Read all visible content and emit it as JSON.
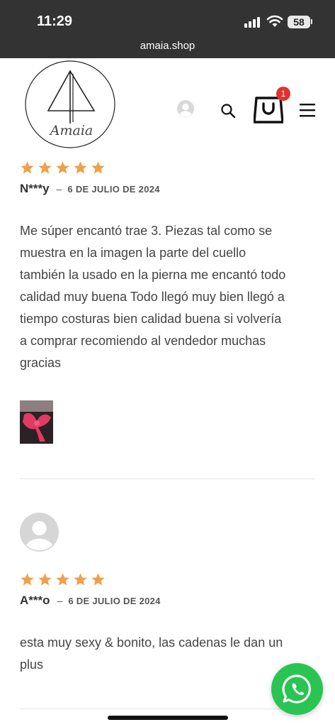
{
  "status_bar": {
    "time": "11:29",
    "battery": "58"
  },
  "browser": {
    "url": "amaia.shop"
  },
  "header": {
    "logo_text": "Amaia",
    "cart_count": "1",
    "icons": [
      "user-avatar-icon",
      "search-icon",
      "shopping-bag-icon",
      "hamburger-menu-icon"
    ]
  },
  "reviews": [
    {
      "rating": 5,
      "author": "N***y",
      "separator": "–",
      "date": "6 DE JULIO DE 2024",
      "lines": [
        "Me súper encantó trae 3. Piezas tal como se",
        "muestra en la imagen la parte del cuello",
        "también la usado en la pierna me encantó todo",
        "calidad muy buena Todo llegó muy bien llegó a",
        "tiempo costuras bien calidad buena si volvería",
        "a comprar recomiendo al vendedor muchas",
        "gracias"
      ]
    },
    {
      "rating": 5,
      "author": "A***o",
      "separator": "–",
      "date": "6 DE JULIO DE 2024",
      "lines": [
        "esta muy sexy & bonito, las cadenas le dan un",
        "plus"
      ]
    }
  ],
  "colors": {
    "star": "#f0a04a",
    "whatsapp": "#29c452",
    "badge": "#e0322e",
    "status_bar": "#333333"
  }
}
